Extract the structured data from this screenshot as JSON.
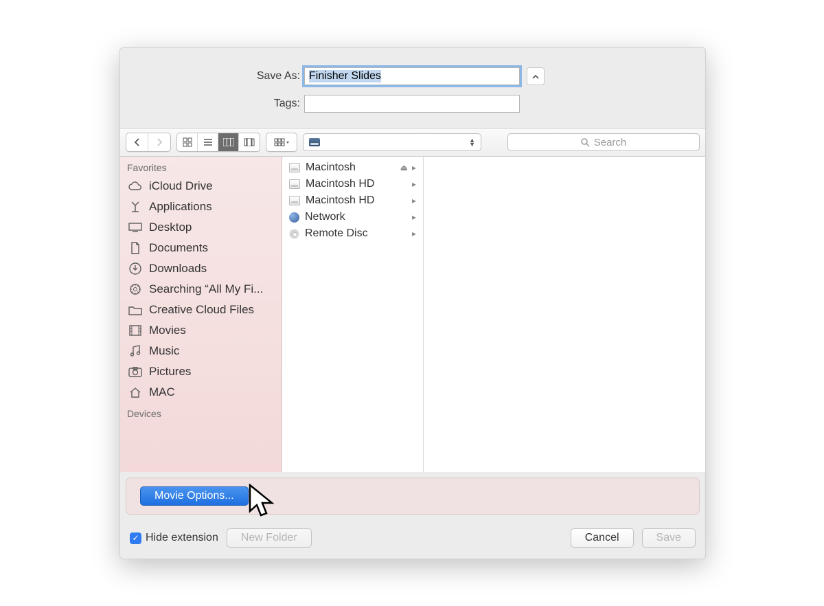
{
  "form": {
    "save_as_label": "Save As:",
    "save_as_value": "Finisher Slides",
    "tags_label": "Tags:",
    "tags_value": ""
  },
  "search": {
    "placeholder": "Search"
  },
  "location": {
    "selected": ""
  },
  "sidebar": {
    "heading_favorites": "Favorites",
    "heading_devices": "Devices",
    "items": [
      {
        "icon": "cloud-icon",
        "label": "iCloud Drive"
      },
      {
        "icon": "apps-icon",
        "label": "Applications"
      },
      {
        "icon": "desktop-icon",
        "label": "Desktop"
      },
      {
        "icon": "documents-icon",
        "label": "Documents"
      },
      {
        "icon": "downloads-icon",
        "label": "Downloads"
      },
      {
        "icon": "search-icon",
        "label": "Searching “All My Fi..."
      },
      {
        "icon": "folder-icon",
        "label": "Creative Cloud Files"
      },
      {
        "icon": "movies-icon",
        "label": "Movies"
      },
      {
        "icon": "music-icon",
        "label": "Music"
      },
      {
        "icon": "pictures-icon",
        "label": "Pictures"
      },
      {
        "icon": "home-icon",
        "label": "MAC"
      }
    ]
  },
  "column_items": [
    {
      "icon": "disk",
      "label": "Macintosh",
      "eject": true
    },
    {
      "icon": "disk",
      "label": "Macintosh HD",
      "eject": false
    },
    {
      "icon": "disk",
      "label": "Macintosh HD",
      "eject": false
    },
    {
      "icon": "globe",
      "label": "Network",
      "eject": false
    },
    {
      "icon": "disc",
      "label": "Remote Disc",
      "eject": false
    }
  ],
  "options": {
    "movie_options_label": "Movie Options..."
  },
  "footer": {
    "hide_ext_label": "Hide extension",
    "hide_ext_checked": true,
    "new_folder_label": "New Folder",
    "cancel_label": "Cancel",
    "save_label": "Save"
  }
}
